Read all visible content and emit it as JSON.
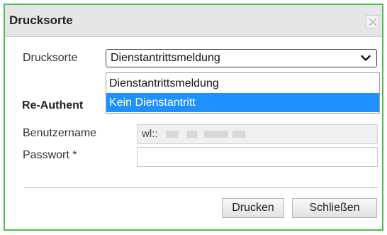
{
  "dialog": {
    "title": "Drucksorte"
  },
  "form": {
    "drucksorte_label": "Drucksorte",
    "drucksorte_selected": "Dienstantrittsmeldung",
    "drucksorte_options": [
      "Dienstantrittsmeldung",
      "Kein Dienstantritt"
    ],
    "highlighted_option": "Kein Dienstantritt",
    "section_heading": "Re-Authent",
    "benutzername_label": "Benutzername",
    "benutzername_value": "wl::",
    "passwort_label": "Passwort *",
    "passwort_value": ""
  },
  "buttons": {
    "print_label": "Drucken",
    "close_label": "Schließen"
  },
  "icons": {
    "close": "close-icon",
    "dropdown": "chevron-down-icon"
  },
  "colors": {
    "border": "#4fbb4a",
    "highlight": "#1e90ff"
  }
}
